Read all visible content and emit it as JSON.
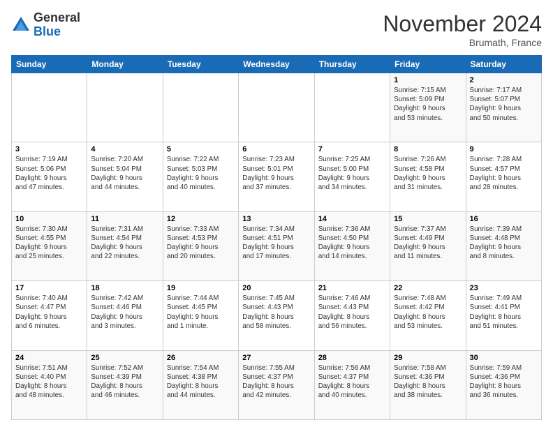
{
  "logo": {
    "general": "General",
    "blue": "Blue"
  },
  "title": "November 2024",
  "location": "Brumath, France",
  "days_header": [
    "Sunday",
    "Monday",
    "Tuesday",
    "Wednesday",
    "Thursday",
    "Friday",
    "Saturday"
  ],
  "weeks": [
    [
      {
        "num": "",
        "info": ""
      },
      {
        "num": "",
        "info": ""
      },
      {
        "num": "",
        "info": ""
      },
      {
        "num": "",
        "info": ""
      },
      {
        "num": "",
        "info": ""
      },
      {
        "num": "1",
        "info": "Sunrise: 7:15 AM\nSunset: 5:09 PM\nDaylight: 9 hours\nand 53 minutes."
      },
      {
        "num": "2",
        "info": "Sunrise: 7:17 AM\nSunset: 5:07 PM\nDaylight: 9 hours\nand 50 minutes."
      }
    ],
    [
      {
        "num": "3",
        "info": "Sunrise: 7:19 AM\nSunset: 5:06 PM\nDaylight: 9 hours\nand 47 minutes."
      },
      {
        "num": "4",
        "info": "Sunrise: 7:20 AM\nSunset: 5:04 PM\nDaylight: 9 hours\nand 44 minutes."
      },
      {
        "num": "5",
        "info": "Sunrise: 7:22 AM\nSunset: 5:03 PM\nDaylight: 9 hours\nand 40 minutes."
      },
      {
        "num": "6",
        "info": "Sunrise: 7:23 AM\nSunset: 5:01 PM\nDaylight: 9 hours\nand 37 minutes."
      },
      {
        "num": "7",
        "info": "Sunrise: 7:25 AM\nSunset: 5:00 PM\nDaylight: 9 hours\nand 34 minutes."
      },
      {
        "num": "8",
        "info": "Sunrise: 7:26 AM\nSunset: 4:58 PM\nDaylight: 9 hours\nand 31 minutes."
      },
      {
        "num": "9",
        "info": "Sunrise: 7:28 AM\nSunset: 4:57 PM\nDaylight: 9 hours\nand 28 minutes."
      }
    ],
    [
      {
        "num": "10",
        "info": "Sunrise: 7:30 AM\nSunset: 4:55 PM\nDaylight: 9 hours\nand 25 minutes."
      },
      {
        "num": "11",
        "info": "Sunrise: 7:31 AM\nSunset: 4:54 PM\nDaylight: 9 hours\nand 22 minutes."
      },
      {
        "num": "12",
        "info": "Sunrise: 7:33 AM\nSunset: 4:53 PM\nDaylight: 9 hours\nand 20 minutes."
      },
      {
        "num": "13",
        "info": "Sunrise: 7:34 AM\nSunset: 4:51 PM\nDaylight: 9 hours\nand 17 minutes."
      },
      {
        "num": "14",
        "info": "Sunrise: 7:36 AM\nSunset: 4:50 PM\nDaylight: 9 hours\nand 14 minutes."
      },
      {
        "num": "15",
        "info": "Sunrise: 7:37 AM\nSunset: 4:49 PM\nDaylight: 9 hours\nand 11 minutes."
      },
      {
        "num": "16",
        "info": "Sunrise: 7:39 AM\nSunset: 4:48 PM\nDaylight: 9 hours\nand 8 minutes."
      }
    ],
    [
      {
        "num": "17",
        "info": "Sunrise: 7:40 AM\nSunset: 4:47 PM\nDaylight: 9 hours\nand 6 minutes."
      },
      {
        "num": "18",
        "info": "Sunrise: 7:42 AM\nSunset: 4:46 PM\nDaylight: 9 hours\nand 3 minutes."
      },
      {
        "num": "19",
        "info": "Sunrise: 7:44 AM\nSunset: 4:45 PM\nDaylight: 9 hours\nand 1 minute."
      },
      {
        "num": "20",
        "info": "Sunrise: 7:45 AM\nSunset: 4:43 PM\nDaylight: 8 hours\nand 58 minutes."
      },
      {
        "num": "21",
        "info": "Sunrise: 7:46 AM\nSunset: 4:43 PM\nDaylight: 8 hours\nand 56 minutes."
      },
      {
        "num": "22",
        "info": "Sunrise: 7:48 AM\nSunset: 4:42 PM\nDaylight: 8 hours\nand 53 minutes."
      },
      {
        "num": "23",
        "info": "Sunrise: 7:49 AM\nSunset: 4:41 PM\nDaylight: 8 hours\nand 51 minutes."
      }
    ],
    [
      {
        "num": "24",
        "info": "Sunrise: 7:51 AM\nSunset: 4:40 PM\nDaylight: 8 hours\nand 48 minutes."
      },
      {
        "num": "25",
        "info": "Sunrise: 7:52 AM\nSunset: 4:39 PM\nDaylight: 8 hours\nand 46 minutes."
      },
      {
        "num": "26",
        "info": "Sunrise: 7:54 AM\nSunset: 4:38 PM\nDaylight: 8 hours\nand 44 minutes."
      },
      {
        "num": "27",
        "info": "Sunrise: 7:55 AM\nSunset: 4:37 PM\nDaylight: 8 hours\nand 42 minutes."
      },
      {
        "num": "28",
        "info": "Sunrise: 7:56 AM\nSunset: 4:37 PM\nDaylight: 8 hours\nand 40 minutes."
      },
      {
        "num": "29",
        "info": "Sunrise: 7:58 AM\nSunset: 4:36 PM\nDaylight: 8 hours\nand 38 minutes."
      },
      {
        "num": "30",
        "info": "Sunrise: 7:59 AM\nSunset: 4:36 PM\nDaylight: 8 hours\nand 36 minutes."
      }
    ]
  ]
}
